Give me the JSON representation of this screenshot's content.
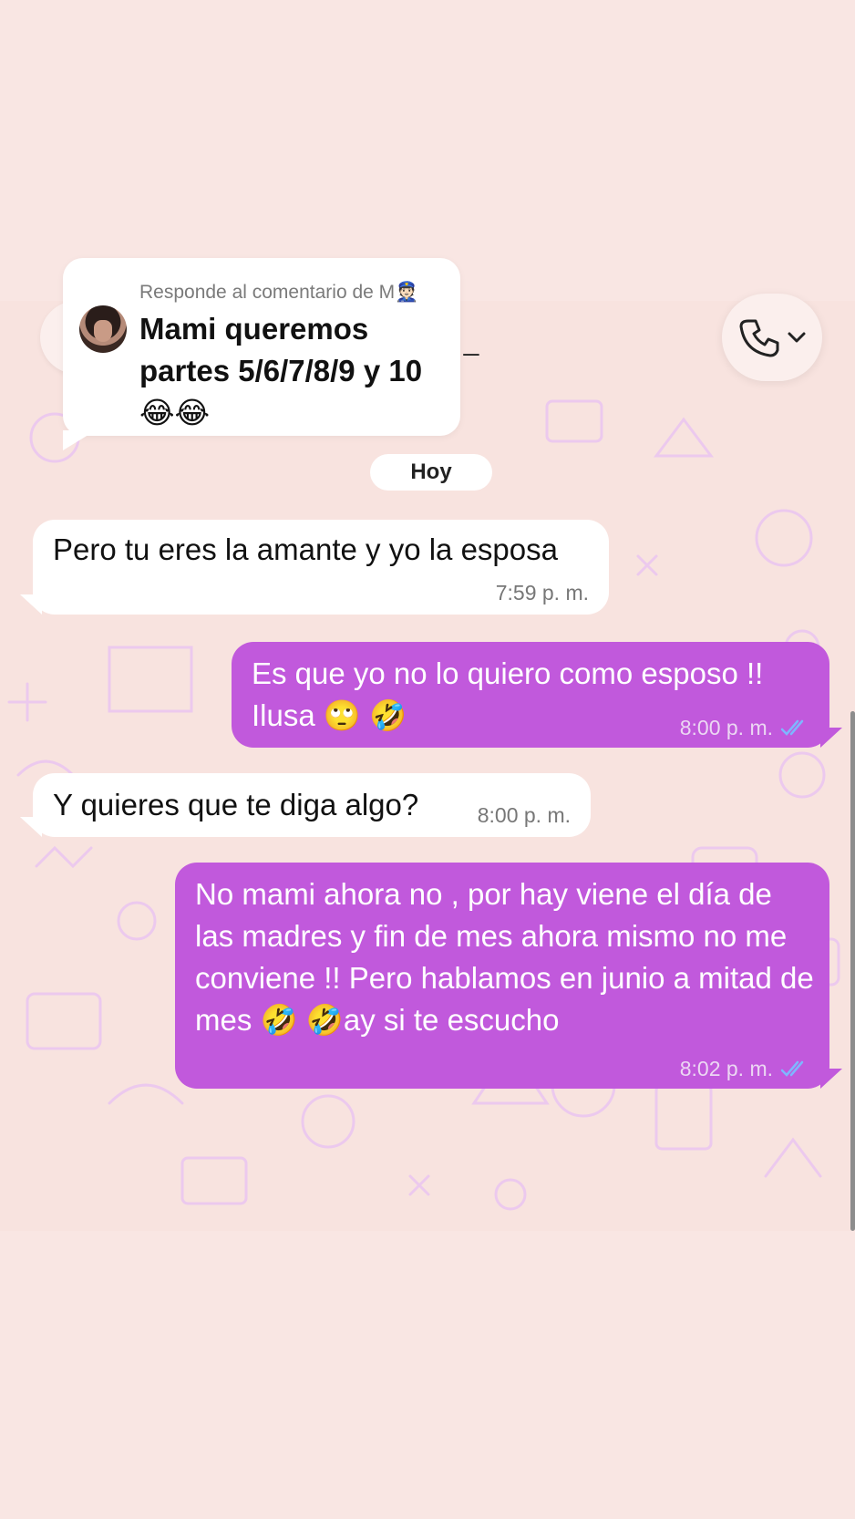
{
  "header": {
    "contact_name": "l_",
    "back_icon": "chevron-left-icon",
    "call_icon": "phone-icon"
  },
  "reply": {
    "caption": "Responde al comentario de M👮🏻",
    "text": "Mami queremos partes 5/6/7/8/9 y 10 😂😂"
  },
  "date_label": "Hoy",
  "messages": [
    {
      "direction": "in",
      "text": "Pero tu eres la amante y yo la esposa",
      "time": "7:59 p. m."
    },
    {
      "direction": "out",
      "text": "Es que yo no lo quiero como esposo !! Ilusa 🙄 🤣",
      "time": "8:00 p. m.",
      "status": "read"
    },
    {
      "direction": "in",
      "text": "Y quieres que te diga algo?",
      "time": "8:00 p. m."
    },
    {
      "direction": "out",
      "text": "No mami ahora no , por hay viene el día de las madres y fin de mes ahora mismo no me conviene !! Pero hablamos en junio a mitad de mes 🤣 🤣ay si te escucho",
      "time": "8:02 p. m.",
      "status": "read"
    }
  ],
  "colors": {
    "page_bg": "#f9e6e3",
    "chat_bg": "#f8e3df",
    "outgoing_bubble": "#c159dc",
    "incoming_bubble": "#ffffff",
    "read_ticks": "#7fb6ff"
  }
}
